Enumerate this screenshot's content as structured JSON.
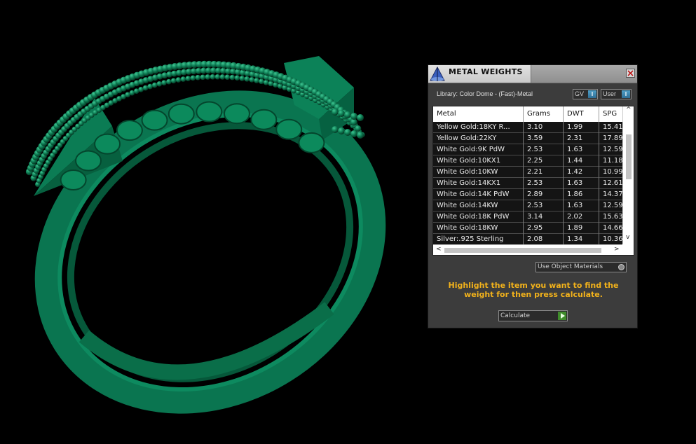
{
  "panel": {
    "title": "METAL WEIGHTS",
    "library_label": "Library: Color Dome - (Fast)-Metal",
    "gv_label": "GV",
    "user_label": "User",
    "toggle_indicator": "I",
    "columns": [
      "Metal",
      "Grams",
      "DWT",
      "SPG"
    ],
    "rows": [
      [
        "Yellow Gold:18KY R...",
        "3.10",
        "1.99",
        "15.41"
      ],
      [
        "Yellow Gold:22KY",
        "3.59",
        "2.31",
        "17.89"
      ],
      [
        "White Gold:9K PdW",
        "2.53",
        "1.63",
        "12.59"
      ],
      [
        "White Gold:10KX1",
        "2.25",
        "1.44",
        "11.18"
      ],
      [
        "White Gold:10KW",
        "2.21",
        "1.42",
        "10.99"
      ],
      [
        "White Gold:14KX1",
        "2.53",
        "1.63",
        "12.61"
      ],
      [
        "White Gold:14K PdW",
        "2.89",
        "1.86",
        "14.37"
      ],
      [
        "White Gold:14KW",
        "2.53",
        "1.63",
        "12.59"
      ],
      [
        "White Gold:18K PdW",
        "3.14",
        "2.02",
        "15.63"
      ],
      [
        "White Gold:18KW",
        "2.95",
        "1.89",
        "14.66"
      ],
      [
        "Silver:.925 Sterling",
        "2.08",
        "1.34",
        "10.36"
      ]
    ],
    "use_object_materials_label": "Use Object Materials",
    "instruction": "Highlight the item you want to find the weight for then press calculate.",
    "calculate_label": "Calculate"
  },
  "colors": {
    "ring": "#0b7a52",
    "panel_bg": "#3c3c3c",
    "instruction_text": "#f2b21b"
  },
  "icons": {
    "logo": "app-logo-icon",
    "close": "close-icon",
    "calculate": "play-arrow-icon"
  }
}
